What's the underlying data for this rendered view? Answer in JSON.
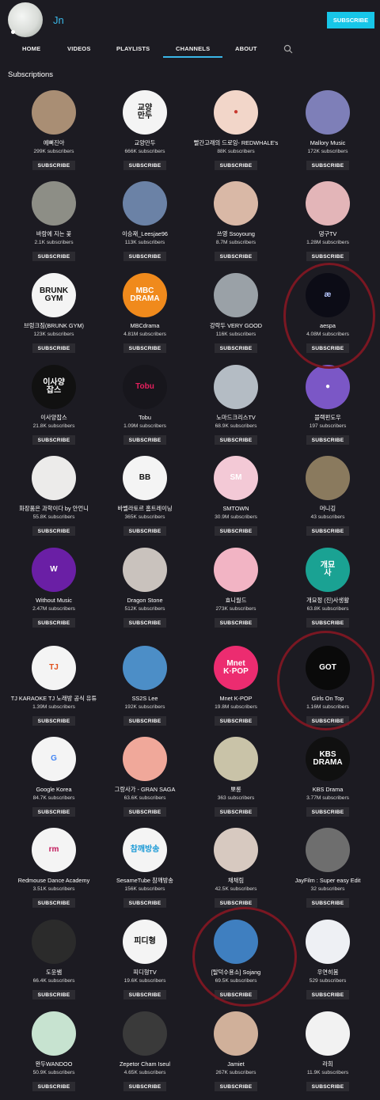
{
  "header": {
    "channel_name": "Jn",
    "subscribe_label": "SUBSCRIBE",
    "tabs": [
      "HOME",
      "VIDEOS",
      "PLAYLISTS",
      "CHANNELS",
      "ABOUT"
    ],
    "active_tab": "CHANNELS"
  },
  "section_title": "Subscriptions",
  "subscribe_button_label": "SUBSCRIBE",
  "accent_color": "#17c6e8",
  "annotation_color": "#7a1722",
  "channels": [
    {
      "name": "예뻐진아",
      "subs": "299K subscribers",
      "icon": "person-photo",
      "bg": "#a98e74",
      "fg": "#fff",
      "glyph": ""
    },
    {
      "name": "교양만두",
      "subs": "666K subscribers",
      "icon": "gyoyang-mandu-logo",
      "bg": "#f4f4f4",
      "fg": "#111",
      "glyph": "교양\n만두"
    },
    {
      "name": "빨간고래의 드로잉- REDWHALE's",
      "subs": "88K subscribers",
      "icon": "illustration-avatar",
      "bg": "#f2d6c9",
      "fg": "#c8392f",
      "glyph": "●"
    },
    {
      "name": "Mallory Music",
      "subs": "172K subscribers",
      "icon": "room-photo",
      "bg": "#7e7fb8",
      "fg": "#fff",
      "glyph": ""
    },
    {
      "name": "바람에 지는 꽃",
      "subs": "2.1K subscribers",
      "icon": "bridge-photo",
      "bg": "#8d8e86",
      "fg": "#fff",
      "glyph": ""
    },
    {
      "name": "이승재_Leesjae96",
      "subs": "113K subscribers",
      "icon": "group-photo",
      "bg": "#6b82a6",
      "fg": "#fff",
      "glyph": ""
    },
    {
      "name": "쓰영 Ssoyoung",
      "subs": "8.7M subscribers",
      "icon": "person-photo",
      "bg": "#d9b8a6",
      "fg": "#fff",
      "glyph": ""
    },
    {
      "name": "댕구TV",
      "subs": "1.28M subscribers",
      "icon": "person-photo",
      "bg": "#e3b5b8",
      "fg": "#fff",
      "glyph": ""
    },
    {
      "name": "브렁크짐(BRUNK GYM)",
      "subs": "123K subscribers",
      "icon": "brunk-gym-logo",
      "bg": "#f4f4f4",
      "fg": "#111",
      "glyph": "BRUNK\nGYM"
    },
    {
      "name": "MBCdrama",
      "subs": "4.81M subscribers",
      "icon": "mbc-drama-logo",
      "bg": "#f08a1c",
      "fg": "#fff",
      "glyph": "MBC\nDRAMA"
    },
    {
      "name": "강락두 VERY GOOD",
      "subs": "116K subscribers",
      "icon": "person-photo",
      "bg": "#9aa1a7",
      "fg": "#fff",
      "glyph": ""
    },
    {
      "name": "aespa",
      "subs": "4.08M subscribers",
      "icon": "aespa-logo",
      "bg": "#0c0c16",
      "fg": "#b8c8ff",
      "glyph": "æ"
    },
    {
      "name": "이사양잡스",
      "subs": "21.8K subscribers",
      "icon": "isayang-jobs-logo",
      "bg": "#111",
      "fg": "#fff",
      "glyph": "이사양\n잡스"
    },
    {
      "name": "Tobu",
      "subs": "1.09M subscribers",
      "icon": "tobu-logo",
      "bg": "#17161c",
      "fg": "#e6205e",
      "glyph": "Tobu"
    },
    {
      "name": "노마드크리스TV",
      "subs": "68.9K subscribers",
      "icon": "person-photo",
      "bg": "#b4bcc4",
      "fg": "#fff",
      "glyph": ""
    },
    {
      "name": "블랙펀도우",
      "subs": "197 subscribers",
      "icon": "default-avatar-icon",
      "bg": "#7b57c6",
      "fg": "#fff",
      "glyph": "●"
    },
    {
      "name": "화장품은 과학이다 by 안언니",
      "subs": "55.8K subscribers",
      "icon": "person-photo",
      "bg": "#ecebea",
      "fg": "#fff",
      "glyph": ""
    },
    {
      "name": "바벨라토르 홈트레이닝",
      "subs": "365K subscribers",
      "icon": "barbellator-logo",
      "bg": "#f4f4f4",
      "fg": "#111",
      "glyph": "BB"
    },
    {
      "name": "SMTOWN",
      "subs": "30.9M subscribers",
      "icon": "smtown-logo",
      "bg": "#f3c9d6",
      "fg": "#fff",
      "glyph": "SM"
    },
    {
      "name": "머니깅",
      "subs": "43 subscribers",
      "icon": "crowd-photo",
      "bg": "#8a7a5e",
      "fg": "#fff",
      "glyph": ""
    },
    {
      "name": "Without Music",
      "subs": "2.47M subscribers",
      "icon": "without-music-logo",
      "bg": "#6a1fa5",
      "fg": "#fff",
      "glyph": "W"
    },
    {
      "name": "Dragon Stone",
      "subs": "512K subscribers",
      "icon": "person-photo",
      "bg": "#c9c2bd",
      "fg": "#fff",
      "glyph": ""
    },
    {
      "name": "효니월드",
      "subs": "273K subscribers",
      "icon": "duck-photo",
      "bg": "#f2b4c4",
      "fg": "#fff",
      "glyph": ""
    },
    {
      "name": "개묘정 (진)사생활",
      "subs": "63.8K subscribers",
      "icon": "gaemyo-logo",
      "bg": "#1aa293",
      "fg": "#fff",
      "glyph": "개묘\n사"
    },
    {
      "name": "TJ KARAOKE TJ 노래방 공식 유튜",
      "subs": "1.39M subscribers",
      "icon": "tj-karaoke-logo",
      "bg": "#f4f4f4",
      "fg": "#e0501c",
      "glyph": "TJ"
    },
    {
      "name": "SS2S Lee",
      "subs": "192K subscribers",
      "icon": "person-photo",
      "bg": "#4c8ec7",
      "fg": "#fff",
      "glyph": ""
    },
    {
      "name": "Mnet K-POP",
      "subs": "19.8M subscribers",
      "icon": "mnet-kpop-logo",
      "bg": "#ec2c70",
      "fg": "#fff",
      "glyph": "Mnet\nK·POP"
    },
    {
      "name": "Girls On Top",
      "subs": "1.16M subscribers",
      "icon": "got-the-beat-logo",
      "bg": "#0a0a0a",
      "fg": "#fff",
      "glyph": "GOT"
    },
    {
      "name": "Google Korea",
      "subs": "84.7K subscribers",
      "icon": "google-logo",
      "bg": "#f4f4f4",
      "fg": "#4285f4",
      "glyph": "G"
    },
    {
      "name": "그랑사가 - GRAN SAGA",
      "subs": "63.6K subscribers",
      "icon": "anime-character",
      "bg": "#f0a89a",
      "fg": "#fff",
      "glyph": ""
    },
    {
      "name": "뽀롱",
      "subs": "363 subscribers",
      "icon": "photo-avatar",
      "bg": "#c9c3a8",
      "fg": "#fff",
      "glyph": ""
    },
    {
      "name": "KBS Drama",
      "subs": "3.77M subscribers",
      "icon": "kbs-drama-logo",
      "bg": "#101010",
      "fg": "#fff",
      "glyph": "KBS\nDRAMA"
    },
    {
      "name": "Redmouse Dance Academy",
      "subs": "3.51K subscribers",
      "icon": "redmouse-logo",
      "bg": "#f4f4f4",
      "fg": "#c2185b",
      "glyph": "rm"
    },
    {
      "name": "SesameTube 참깨방송",
      "subs": "156K subscribers",
      "icon": "sesametube-logo",
      "bg": "#f4f4f4",
      "fg": "#1b9ad6",
      "glyph": "참깨방송"
    },
    {
      "name": "채채림",
      "subs": "42.5K subscribers",
      "icon": "person-photo",
      "bg": "#d7c9c0",
      "fg": "#fff",
      "glyph": ""
    },
    {
      "name": "JayFilm : Super easy Edit",
      "subs": "32 subscribers",
      "icon": "camera-photo",
      "bg": "#6e6e6e",
      "fg": "#fff",
      "glyph": ""
    },
    {
      "name": "도윤쌤",
      "subs": "66.4K subscribers",
      "icon": "person-photo",
      "bg": "#2b2b2b",
      "fg": "#fff",
      "glyph": ""
    },
    {
      "name": "피디형TV",
      "subs": "19.6K subscribers",
      "icon": "pd-hyung-logo",
      "bg": "#f4f4f4",
      "fg": "#111",
      "glyph": "피디형"
    },
    {
      "name": "[탈덕수용소] Sojang",
      "subs": "69.5K subscribers",
      "icon": "cartoon-avatar",
      "bg": "#3f7fc0",
      "fg": "#fff",
      "glyph": ""
    },
    {
      "name": "우연히봄",
      "subs": "529 subscribers",
      "icon": "illustration-avatar",
      "bg": "#eef0f4",
      "fg": "#223",
      "glyph": ""
    },
    {
      "name": "완두WANDOO",
      "subs": "50.9K subscribers",
      "icon": "mushroom-illustration",
      "bg": "#c7e3d0",
      "fg": "#6a4a8a",
      "glyph": ""
    },
    {
      "name": "Zepetor Cham Iseul",
      "subs": "4.65K subscribers",
      "icon": "person-photo",
      "bg": "#3a3a3a",
      "fg": "#fff",
      "glyph": ""
    },
    {
      "name": "Jamiet",
      "subs": "267K subscribers",
      "icon": "person-photo",
      "bg": "#d0b09a",
      "fg": "#fff",
      "glyph": ""
    },
    {
      "name": "라희",
      "subs": "11.9K subscribers",
      "icon": "bunny-illustration",
      "bg": "#f2f2f2",
      "fg": "#c98a9b",
      "glyph": ""
    }
  ]
}
